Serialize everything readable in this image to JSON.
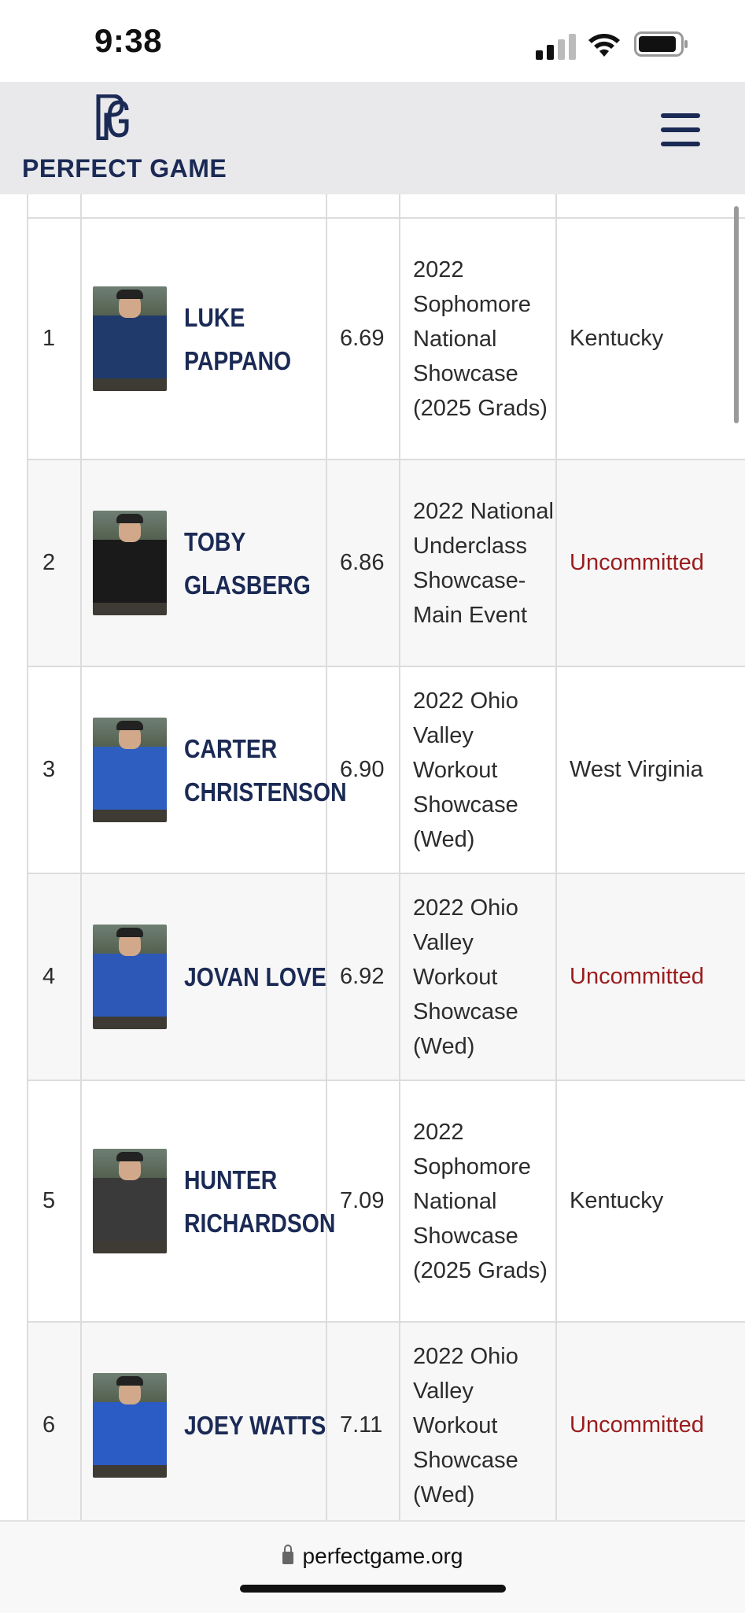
{
  "status_bar": {
    "time": "9:38"
  },
  "header": {
    "logo_text": "PERFECT GAME",
    "menu_icon": "hamburger-menu-icon"
  },
  "table": {
    "rows": [
      {
        "rank": "1",
        "player": "LUKE PAPPANO",
        "name_lines": [
          "LUKE",
          "PAPPANO"
        ],
        "sixty": "6.69",
        "event": "2022 Sophomore National Showcase (2025 Grads)",
        "commitment": "Kentucky",
        "committed": true,
        "photo_color": "#1f3a6b"
      },
      {
        "rank": "2",
        "player": "TOBY GLASBERG",
        "name_lines": [
          "TOBY",
          "GLASBERG"
        ],
        "sixty": "6.86",
        "event": "2022 National Underclass Showcase-Main Event",
        "commitment": "Uncommitted",
        "committed": false,
        "photo_color": "#1a1a1a"
      },
      {
        "rank": "3",
        "player": "CARTER CHRISTENSON",
        "name_lines": [
          "CARTER",
          "CHRISTENSON"
        ],
        "sixty": "6.90",
        "event": "2022 Ohio Valley Workout Showcase (Wed)",
        "commitment": "West Virginia",
        "committed": true,
        "photo_color": "#2e5fc0"
      },
      {
        "rank": "4",
        "player": "JOVAN LOVE",
        "name_lines": [
          "JOVAN LOVE"
        ],
        "sixty": "6.92",
        "event": "2022 Ohio Valley Workout Showcase (Wed)",
        "commitment": "Uncommitted",
        "committed": false,
        "photo_color": "#2d58b8"
      },
      {
        "rank": "5",
        "player": "HUNTER RICHARDSON",
        "name_lines": [
          "HUNTER",
          "RICHARDSON"
        ],
        "sixty": "7.09",
        "event": "2022 Sophomore National Showcase (2025 Grads)",
        "commitment": "Kentucky",
        "committed": true,
        "photo_color": "#3a3a3a"
      },
      {
        "rank": "6",
        "player": "JOEY WATTS",
        "name_lines": [
          "JOEY WATTS"
        ],
        "sixty": "7.11",
        "event": "2022 Ohio Valley Workout Showcase (Wed)",
        "commitment": "Uncommitted",
        "committed": false,
        "photo_color": "#2b5bc4"
      }
    ]
  },
  "bottom_bar": {
    "url": "perfectgame.org"
  },
  "colors": {
    "brand_navy": "#1b2a55",
    "uncommitted_red": "#9b1c1c",
    "header_bg": "#e9e9eb"
  }
}
